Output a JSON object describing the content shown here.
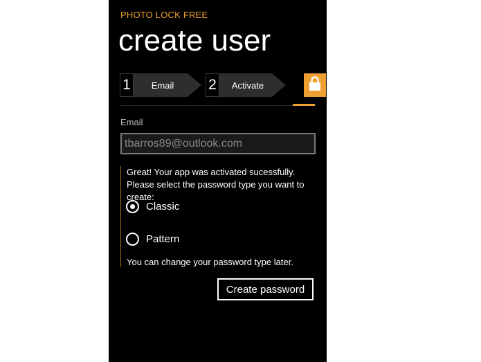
{
  "app": {
    "title": "PHOTO LOCK FREE",
    "page_title": "create user",
    "accent": "#f0a030"
  },
  "steps": [
    {
      "number": "1",
      "label": "Email"
    },
    {
      "number": "2",
      "label": "Activate"
    }
  ],
  "lock_step": {
    "icon": "lock-icon"
  },
  "form": {
    "email_label": "Email",
    "email_value": "tbarros89@outlook.com"
  },
  "message": {
    "text": "Great! Your app was activated sucessfully. Please select the password type you want to create:",
    "note": "You can change your password type later."
  },
  "password_types": [
    {
      "label": "Classic",
      "selected": true
    },
    {
      "label": "Pattern",
      "selected": false
    }
  ],
  "actions": {
    "create_label": "Create password"
  }
}
